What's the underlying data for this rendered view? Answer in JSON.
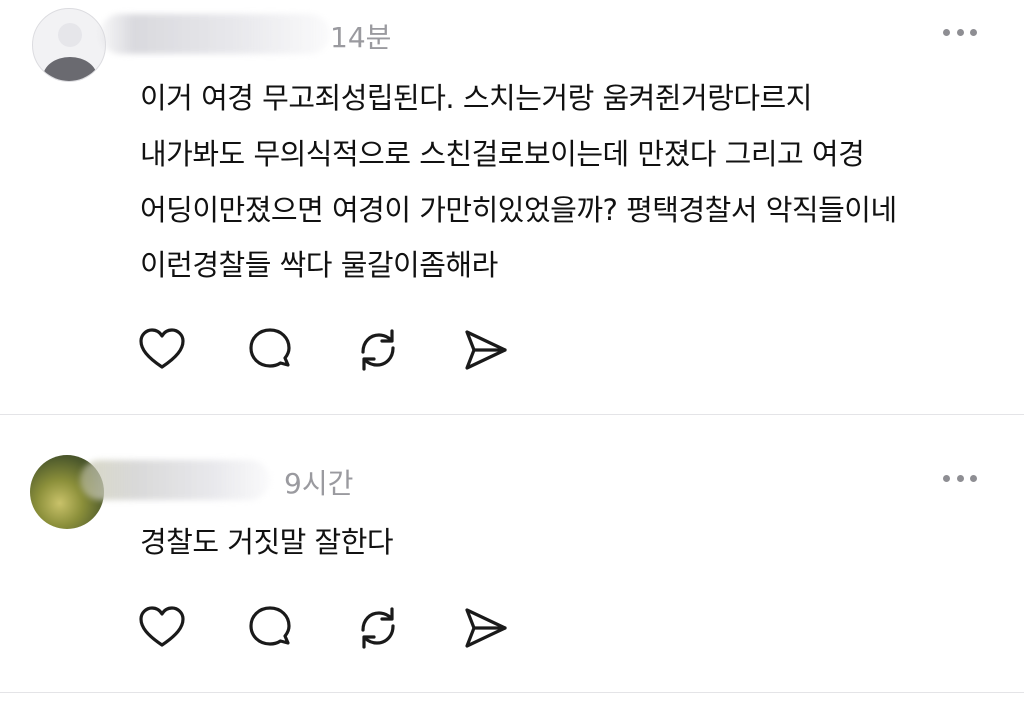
{
  "comments": [
    {
      "time": "14분",
      "lines": [
        "이거 여경 무고죄성립된다. 스치는거랑 움켜쥔거랑다르지",
        "내가봐도 무의식적으로 스친걸로보이는데 만졌다 그리고 여경",
        "어딩이만졌으면 여경이 가만히있었을까? 평택경찰서 악직들이네",
        "이런경찰들 싹다 물갈이좀해라"
      ]
    },
    {
      "time": "9시간",
      "lines": [
        "경찰도 거짓말 잘한다"
      ]
    }
  ],
  "icons": {
    "like": "heart-icon",
    "comment": "speech-bubble-icon",
    "repost": "repost-icon",
    "share": "send-icon",
    "more": "ellipsis-icon"
  },
  "colors": {
    "text": "#111111",
    "muted": "#9a9a9f",
    "icon": "#1a1a1a",
    "divider": "#e4e4e7"
  }
}
